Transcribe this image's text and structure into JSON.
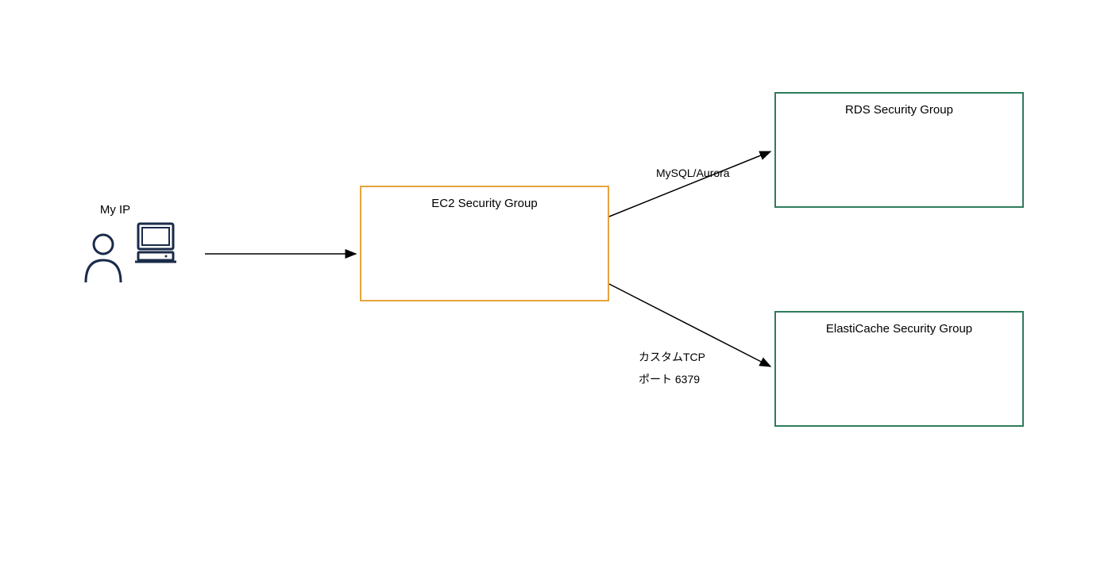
{
  "diagram": {
    "source": {
      "label": "My IP"
    },
    "ec2": {
      "label": "EC2 Security Group",
      "color": "#e8a33d"
    },
    "rds": {
      "label": "RDS Security Group",
      "color": "#2e7d5b"
    },
    "elasticache": {
      "label": "ElastiCache Security Group",
      "color": "#2e7d5b"
    },
    "edges": {
      "to_rds": {
        "label": "MySQL/Aurora"
      },
      "to_elasticache": {
        "line1": "カスタムTCP",
        "line2": "ポート 6379"
      }
    }
  }
}
